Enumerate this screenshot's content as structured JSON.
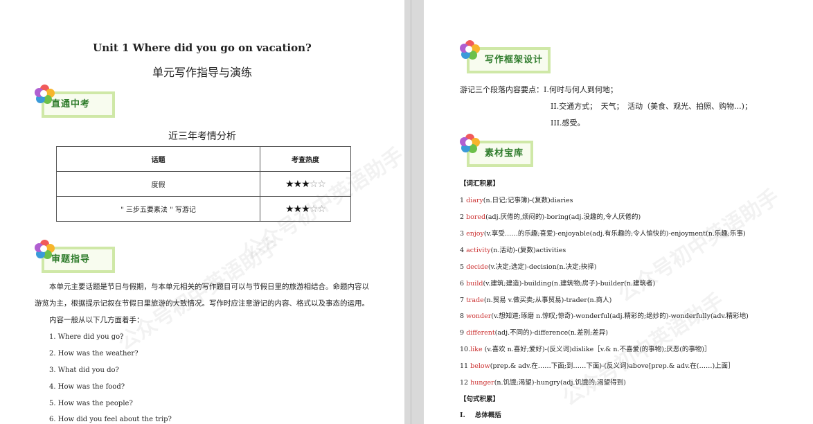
{
  "left": {
    "title_en": "Unit 1 Where did you go on vacation?",
    "title_cn": "单元写作指导与演练",
    "section1": "直通中考",
    "table_title": "近三年考情分析",
    "table": {
      "headers": [
        "话题",
        "考查热度"
      ],
      "rows": [
        {
          "topic": "度假",
          "stars_on": "★★★",
          "stars_off": "☆☆"
        },
        {
          "topic": "\" 三步五要素法 \" 写游记",
          "stars_on": "★★★",
          "stars_off": "☆☆"
        }
      ]
    },
    "section2": "审题指导",
    "para1_line1": "本单元主要话题是节日与假期，与本单元相关的写作题目可以与节假日里的旅游相结合。命题内容以",
    "para1_line2": "游览为主，根据提示记叙在节假日里旅游的大致情况。写作时应注意游记的内容、格式以及事态的运用。",
    "para2": "内容一般从以下几方面着手：",
    "questions": [
      "1. Where did you go?",
      "2. How was the weather?",
      "3. What did you do?",
      "4. How was the food?",
      "5. How was the people?",
      "6. How did you feel about the trip?"
    ]
  },
  "right": {
    "section1": "写作框架设计",
    "frame_line1": "游记三个段落内容要点：I.何时与何人到何地；",
    "frame_line2": "II.交通方式；　天气；　活动（美食、观光、拍照、购物...)；",
    "frame_line3": "III.感受。",
    "section2": "素材宝库",
    "vocab_header": "【词汇积累】",
    "vocab": [
      {
        "num": "1 ",
        "kw": "diary",
        "rest": "(n.日记;记事簿)-(复数)diaries"
      },
      {
        "num": "2 ",
        "kw": "bored",
        "rest": "(adj.厌倦的,烦闷的)-boring(adj.没趣的,令人厌倦的)"
      },
      {
        "num": "3 ",
        "kw": "enjoy",
        "rest": "(v.享受……的乐趣;喜爱)-enjoyable(adj.有乐趣的;令人愉快的)-enjoyment(n.乐趣;乐事)"
      },
      {
        "num": "4 ",
        "kw": "activity",
        "rest": "(n.活动)-(复数)activities"
      },
      {
        "num": "5 ",
        "kw": "decide",
        "rest": "(v.决定;选定)-decision(n.决定;抉择)"
      },
      {
        "num": "6 ",
        "kw": "build",
        "rest": "(v.建筑;建造)-building(n.建筑物;房子)-builder(n.建筑者)"
      },
      {
        "num": "7 ",
        "kw": "trade",
        "rest": "(n.贸易 v.做买卖;从事贸易)-trader(n.商人)"
      },
      {
        "num": "8 ",
        "kw": "wonder",
        "rest": "(v.想知道;琢磨 n.惊叹;惊奇)-wonderful(adj.精彩的;绝妙的)-wonderfully(adv.精彩地)"
      },
      {
        "num": "9 ",
        "kw": "different",
        "rest": "(adj.不同的)-difference(n.差别;差异)"
      },
      {
        "num": "10.",
        "kw": "like",
        "rest": " (v.喜欢 n.喜好;爱好)-(反义词)dislike［v.& n.不喜爱(的事物);厌恶(的事物)］"
      },
      {
        "num": "11 ",
        "kw": "below",
        "rest": "(prep.& adv.在……下面;到……下面)-(反义词)above[prep.& adv.在(……)上面］"
      },
      {
        "num": "12 ",
        "kw": "hunger",
        "rest": "(n.饥饿;渴望)-hungry(adj.饥饿的;渴望得到)"
      }
    ],
    "sentence_header": "【句式积累】",
    "sub1_num": "I.",
    "sub1_label": "总体概括"
  },
  "watermark": "公众号初中英语助手",
  "colors": {
    "keyword": "#cc3333",
    "section_green": "#2f7c2c",
    "section_border": "#cfe8a7"
  }
}
